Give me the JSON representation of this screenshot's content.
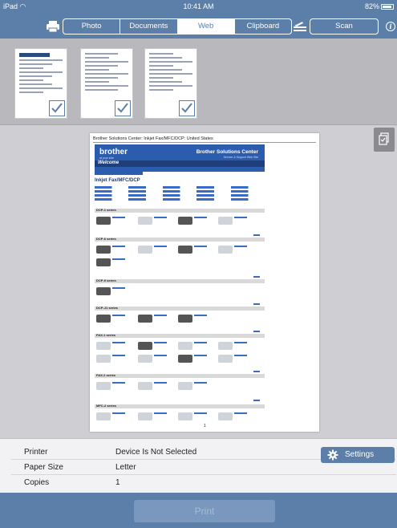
{
  "status_bar": {
    "device": "iPad",
    "time": "10:41 AM",
    "battery": "82%"
  },
  "toolbar": {
    "tabs": [
      {
        "label": "Photo"
      },
      {
        "label": "Documents"
      },
      {
        "label": "Web",
        "active": true
      },
      {
        "label": "Clipboard"
      }
    ],
    "scan_label": "Scan",
    "info_glyph": "i"
  },
  "thumbnails": [
    {
      "checked": true
    },
    {
      "checked": true
    },
    {
      "checked": true
    }
  ],
  "preview": {
    "page_title": "Brother Solutions Center: Inkjet Fax/MFC/DCP: United States",
    "brand": "brother",
    "brand_tag": "at your side",
    "center_title": "Brother Solutions Center",
    "center_tag": "Service & Support Web Site",
    "welcome": "Welcome",
    "heading": "Inkjet Fax/MFC/DCP",
    "sections": [
      "DCP-1 series",
      "DCP-6 series",
      "DCP-9 series",
      "DCP-J1 series",
      "FAX-1 series",
      "FAX-2 series",
      "MFC-2 series"
    ],
    "page_number": "1"
  },
  "settings": {
    "rows": [
      {
        "label": "Printer",
        "value": "Device Is Not Selected"
      },
      {
        "label": "Paper Size",
        "value": "Letter"
      },
      {
        "label": "Copies",
        "value": "1"
      }
    ],
    "button_label": "Settings"
  },
  "print_label": "Print",
  "colors": {
    "accent": "#5b7fa8",
    "check": "#5b7fa8"
  }
}
